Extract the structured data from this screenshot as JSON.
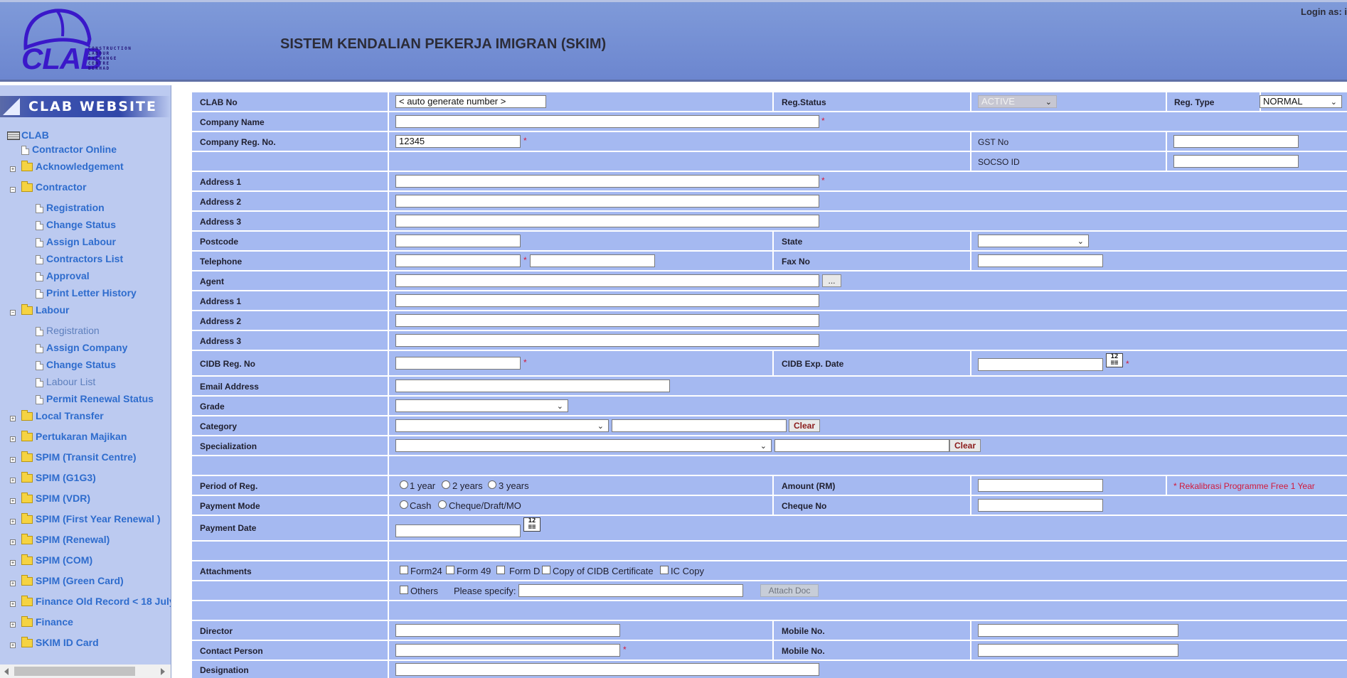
{
  "header": {
    "logo_text": "CLAB",
    "logo_subtitle": "CONSTRUCTION LABOUR EXCHANGE CENTRE BERHAD",
    "title": "SISTEM KENDALIAN PEKERJA IMIGRAN (SKIM)",
    "login_label": "Login as: i"
  },
  "sidebar": {
    "banner": "CLAB WEBSITE",
    "root": "CLAB",
    "items": [
      {
        "label": "Contractor Online",
        "type": "doc"
      },
      {
        "label": "Acknowledgement",
        "type": "folder"
      },
      {
        "label": "Contractor",
        "type": "folder-open"
      },
      {
        "label": "Registration",
        "type": "doc"
      },
      {
        "label": "Change Status",
        "type": "doc"
      },
      {
        "label": "Assign Labour",
        "type": "doc"
      },
      {
        "label": "Contractors List",
        "type": "doc"
      },
      {
        "label": "Approval",
        "type": "doc"
      },
      {
        "label": "Print Letter History",
        "type": "doc"
      },
      {
        "label": "Labour",
        "type": "folder-open"
      },
      {
        "label": "Registration",
        "type": "doc"
      },
      {
        "label": "Assign Company",
        "type": "doc"
      },
      {
        "label": "Change Status",
        "type": "doc"
      },
      {
        "label": "Labour List",
        "type": "doc"
      },
      {
        "label": "Permit Renewal Status",
        "type": "doc"
      },
      {
        "label": "Local Transfer",
        "type": "folder"
      },
      {
        "label": "Pertukaran Majikan",
        "type": "folder"
      },
      {
        "label": "SPIM (Transit Centre)",
        "type": "folder"
      },
      {
        "label": "SPIM (G1G3)",
        "type": "folder"
      },
      {
        "label": "SPIM (VDR)",
        "type": "folder"
      },
      {
        "label": "SPIM (First Year Renewal )",
        "type": "folder"
      },
      {
        "label": "SPIM (Renewal)",
        "type": "folder"
      },
      {
        "label": "SPIM (COM)",
        "type": "folder"
      },
      {
        "label": "SPIM (Green Card)",
        "type": "folder"
      },
      {
        "label": "Finance Old Record < 18 July",
        "type": "folder"
      },
      {
        "label": "Finance",
        "type": "folder"
      },
      {
        "label": "SKIM ID Card",
        "type": "folder"
      }
    ]
  },
  "form": {
    "clab_no_label": "CLAB No",
    "clab_no_value": "< auto generate number >",
    "reg_status_label": "Reg.Status",
    "reg_status_value": "ACTIVE",
    "reg_type_label": "Reg. Type",
    "reg_type_value": "NORMAL",
    "company_name_label": "Company Name",
    "company_reg_no_label": "Company Reg. No.",
    "company_reg_no_value": "12345",
    "gst_no_label": "GST No",
    "socso_id_label": "SOCSO ID",
    "address1_label": "Address 1",
    "address2_label": "Address 2",
    "address3_label": "Address 3",
    "postcode_label": "Postcode",
    "state_label": "State",
    "telephone_label": "Telephone",
    "fax_no_label": "Fax No",
    "agent_label": "Agent",
    "agent_button": "...",
    "agent_address1_label": "Address 1",
    "agent_address2_label": "Address 2",
    "agent_address3_label": "Address 3",
    "cidb_reg_no_label": "CIDB Reg. No",
    "cidb_exp_date_label": "CIDB Exp. Date",
    "email_label": "Email Address",
    "grade_label": "Grade",
    "category_label": "Category",
    "clear_label": "Clear",
    "specialization_label": "Specialization",
    "period_label": "Period of Reg.",
    "period_options": [
      "1 year",
      "2 years",
      "3 years"
    ],
    "amount_label": "Amount (RM)",
    "rekalibrasi_note": "* Rekalibrasi Programme Free 1 Year",
    "payment_mode_label": "Payment Mode",
    "payment_options": [
      "Cash",
      "Cheque/Draft/MO"
    ],
    "cheque_no_label": "Cheque No",
    "payment_date_label": "Payment Date",
    "attachments_label": "Attachments",
    "attachment_options": [
      "Form24",
      "Form 49",
      "Form D",
      "Copy of CIDB Certificate",
      "IC Copy"
    ],
    "others_label": "Others",
    "please_specify_label": "Please specify:",
    "attach_doc_label": "Attach Doc",
    "director_label": "Director",
    "mobile_no_label": "Mobile No.",
    "contact_person_label": "Contact Person",
    "mobile_no2_label": "Mobile No.",
    "designation_label": "Designation",
    "required_mark": "*",
    "calendar_icon_text": "12"
  },
  "colors": {
    "header_bg": "#7f9ad9",
    "form_row_bg": "#a5b9f1",
    "sidebar_bg": "#bccaf0",
    "required": "#d2183a",
    "link": "#2e6ccd"
  }
}
